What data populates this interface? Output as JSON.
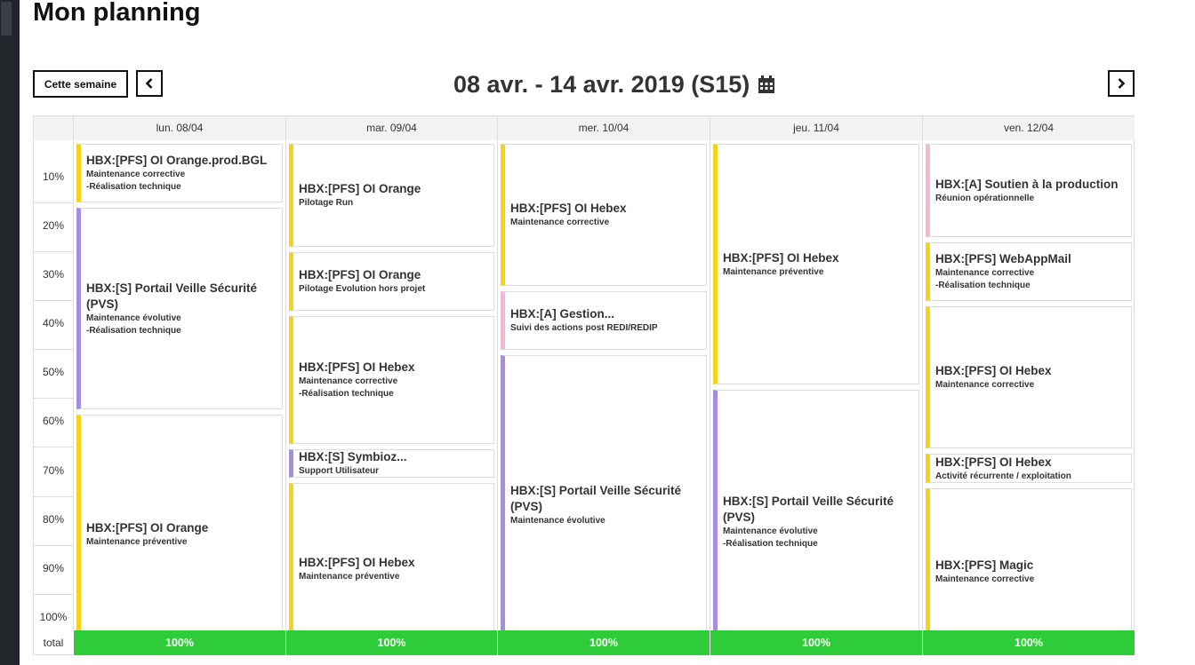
{
  "page_title": "Mon planning",
  "toolbar": {
    "this_week_label": "Cette semaine",
    "prev_icon": "chevron-left-icon",
    "next_icon": "chevron-right-icon",
    "week_range": "08 avr. - 14 avr. 2019 (S15)",
    "calendar_icon": "calendar-icon"
  },
  "y_axis": [
    "10%",
    "20%",
    "30%",
    "40%",
    "50%",
    "60%",
    "70%",
    "80%",
    "90%",
    "100%"
  ],
  "total_label": "total",
  "colors": {
    "yellow": "#f6d31a",
    "purple": "#a58ee0",
    "pink": "#f8b6d7",
    "total_green": "#2ecc38"
  },
  "days": [
    {
      "label": "lun. 08/04",
      "total": "100%",
      "events": [
        {
          "title": "HBX:[PFS] OI Orange.prod.BGL",
          "sub": "Maintenance corrective\n-Réalisation technique",
          "color": "yellow"
        },
        {
          "title": "HBX:[S] Portail Veille Sécurité (PVS)",
          "sub": "Maintenance évolutive\n-Réalisation technique",
          "color": "purple"
        },
        {
          "title": "HBX:[PFS] OI Orange",
          "sub": "Maintenance préventive",
          "color": "yellow"
        }
      ]
    },
    {
      "label": "mar. 09/04",
      "total": "100%",
      "events": [
        {
          "title": "HBX:[PFS] OI Orange",
          "sub": "Pilotage Run",
          "color": "yellow"
        },
        {
          "title": "HBX:[PFS] OI Orange",
          "sub": "Pilotage Evolution hors projet",
          "color": "yellow"
        },
        {
          "title": "HBX:[PFS] OI Hebex",
          "sub": "Maintenance corrective\n-Réalisation technique",
          "color": "yellow"
        },
        {
          "title": "HBX:[S] Symbioz...",
          "sub": "Support Utilisateur",
          "color": "purple"
        },
        {
          "title": "HBX:[PFS] OI Hebex",
          "sub": "Maintenance préventive",
          "color": "yellow"
        }
      ]
    },
    {
      "label": "mer. 10/04",
      "total": "100%",
      "events": [
        {
          "title": "HBX:[PFS] OI Hebex",
          "sub": "Maintenance corrective",
          "color": "yellow"
        },
        {
          "title": "HBX:[A] Gestion...",
          "sub": "Suivi des actions post REDI/REDIP",
          "color": "pink"
        },
        {
          "title": "HBX:[S] Portail Veille Sécurité (PVS)",
          "sub": "Maintenance évolutive",
          "color": "purple"
        }
      ]
    },
    {
      "label": "jeu. 11/04",
      "total": "100%",
      "events": [
        {
          "title": "HBX:[PFS] OI Hebex",
          "sub": "Maintenance préventive",
          "color": "yellow"
        },
        {
          "title": "HBX:[S] Portail Veille Sécurité (PVS)",
          "sub": "Maintenance évolutive\n-Réalisation technique",
          "color": "purple"
        }
      ]
    },
    {
      "label": "ven. 12/04",
      "total": "100%",
      "events": [
        {
          "title": "HBX:[A] Soutien à la production",
          "sub": "Réunion opérationnelle",
          "color": "pink"
        },
        {
          "title": "HBX:[PFS] WebAppMail",
          "sub": "Maintenance corrective\n-Réalisation technique",
          "color": "yellow"
        },
        {
          "title": "HBX:[PFS] OI Hebex",
          "sub": "Maintenance corrective",
          "color": "yellow"
        },
        {
          "title": "HBX:[PFS] OI Hebex",
          "sub": "Activité récurrente / exploitation",
          "color": "yellow"
        },
        {
          "title": "HBX:[PFS] Magic",
          "sub": "Maintenance corrective",
          "color": "yellow"
        }
      ]
    }
  ]
}
